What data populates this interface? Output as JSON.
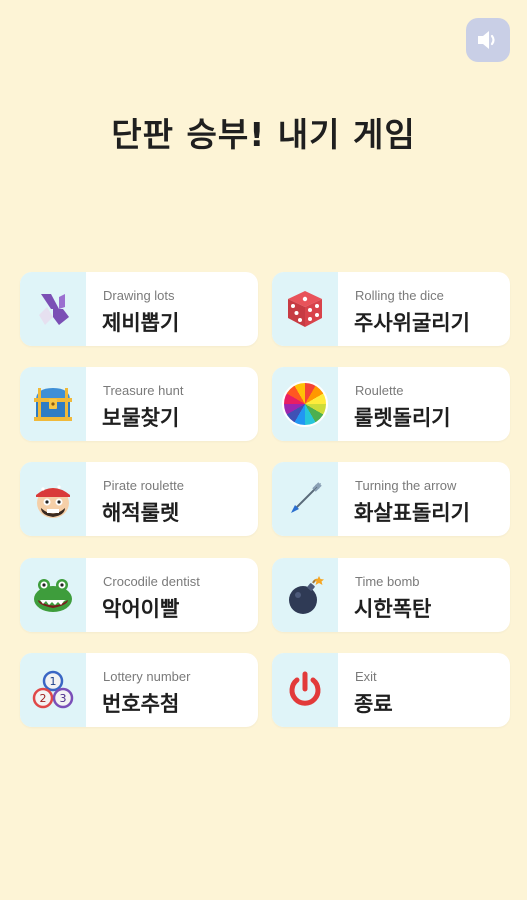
{
  "header": {
    "title": "단판 승부! 내기 게임",
    "sound_icon": "speaker-icon"
  },
  "menu": [
    {
      "en": "Drawing lots",
      "ko": "제비뽑기",
      "icon": "lots-icon"
    },
    {
      "en": "Rolling the dice",
      "ko": "주사위굴리기",
      "icon": "dice-icon"
    },
    {
      "en": "Treasure hunt",
      "ko": "보물찾기",
      "icon": "treasure-chest-icon"
    },
    {
      "en": "Roulette",
      "ko": "룰렛돌리기",
      "icon": "roulette-wheel-icon"
    },
    {
      "en": "Pirate roulette",
      "ko": "해적룰렛",
      "icon": "pirate-icon"
    },
    {
      "en": "Turning the arrow",
      "ko": "화살표돌리기",
      "icon": "arrow-icon"
    },
    {
      "en": "Crocodile dentist",
      "ko": "악어이빨",
      "icon": "crocodile-icon"
    },
    {
      "en": "Time bomb",
      "ko": "시한폭탄",
      "icon": "bomb-icon"
    },
    {
      "en": "Lottery number",
      "ko": "번호추첨",
      "icon": "lottery-balls-icon"
    },
    {
      "en": "Exit",
      "ko": "종료",
      "icon": "power-icon"
    }
  ],
  "lottery_numbers": [
    "1",
    "2",
    "3"
  ],
  "colors": {
    "background": "#fdf4d6",
    "card": "#ffffff",
    "icon_box": "#dff4f8",
    "sound_button": "#c9cfe6"
  }
}
